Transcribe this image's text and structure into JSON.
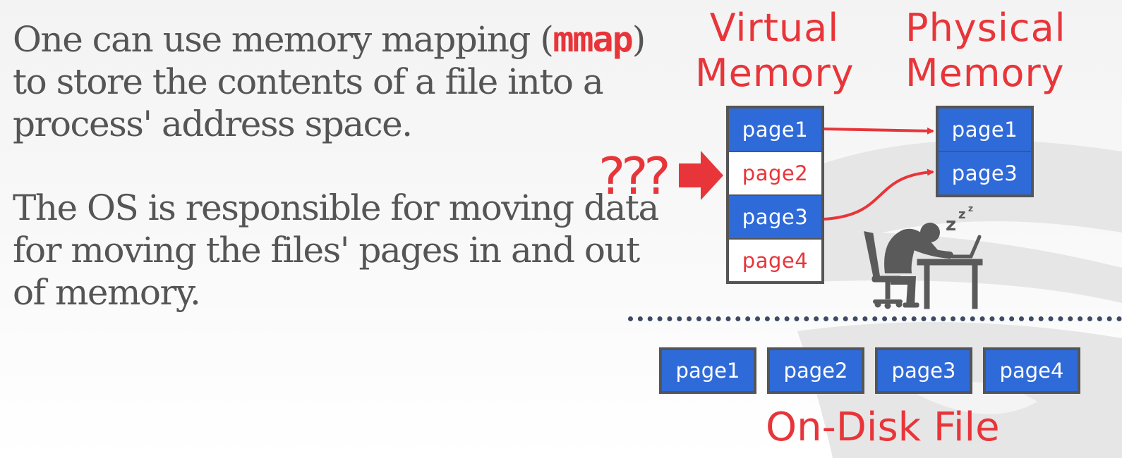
{
  "text": {
    "para1_line1_pre": "One can use memory mapping (",
    "para1_code": "mmap",
    "para1_line1_post": ")",
    "para1_line2": "to store the contents of a file into a",
    "para1_line3": "process' address space.",
    "para2_line1": "The OS is responsible for moving data",
    "para2_line2": "for moving the files' pages in and out",
    "para2_line3": "of memory."
  },
  "diagram": {
    "virtual_heading": [
      "Virtual",
      "Memory"
    ],
    "physical_heading": [
      "Physical",
      "Memory"
    ],
    "question_marks": "???",
    "virtual_pages": [
      {
        "label": "page1",
        "in_memory": true
      },
      {
        "label": "page2",
        "in_memory": false
      },
      {
        "label": "page3",
        "in_memory": true
      },
      {
        "label": "page4",
        "in_memory": false
      }
    ],
    "physical_pages": [
      "page1",
      "page3"
    ],
    "disk_pages": [
      "page1",
      "page2",
      "page3",
      "page4"
    ],
    "disk_label": "On-Disk File",
    "sleep_text": [
      "z",
      "z",
      "z"
    ],
    "icons": [
      "sleeping-person-at-desk-icon",
      "arrow-right-icon",
      "database-logo-watermark"
    ]
  },
  "colors": {
    "accent_red": "#e8353a",
    "page_blue": "#2f6ad9",
    "border_gray": "#555555",
    "text_gray": "#555555",
    "divider": "#3d4a66"
  }
}
